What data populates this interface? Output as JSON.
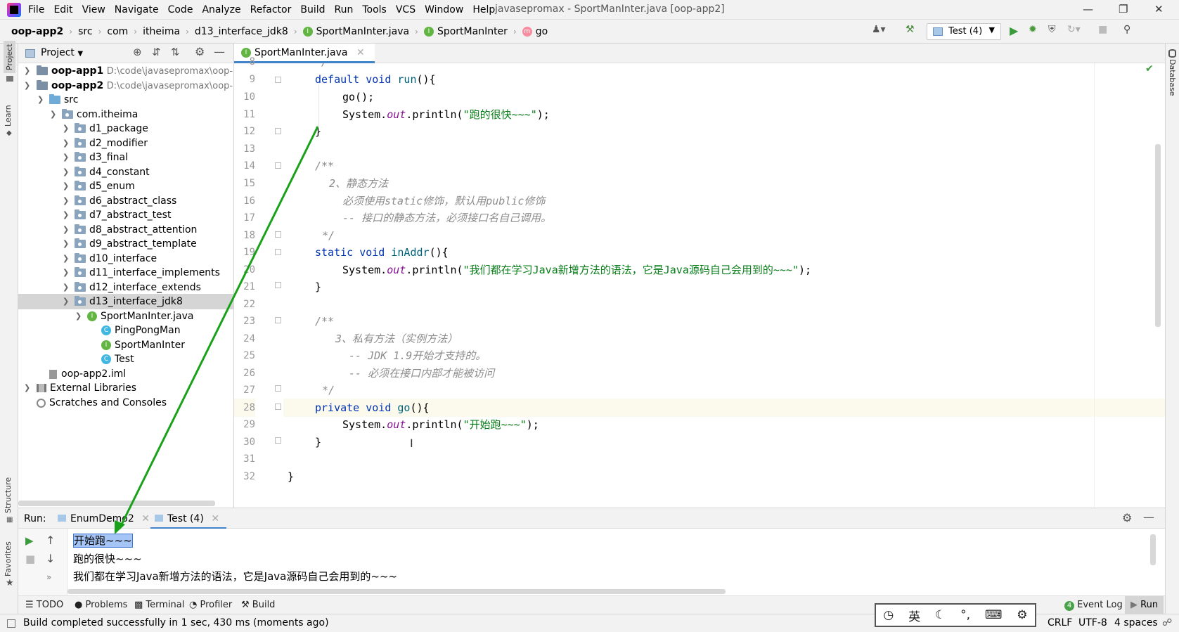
{
  "menu": {
    "items": [
      "File",
      "Edit",
      "View",
      "Navigate",
      "Code",
      "Analyze",
      "Refactor",
      "Build",
      "Run",
      "Tools",
      "VCS",
      "Window",
      "Help"
    ],
    "window_title": "javasepromax - SportManInter.java [oop-app2]"
  },
  "breadcrumbs": [
    "oop-app2",
    "src",
    "com",
    "itheima",
    "d13_interface_jdk8",
    "SportManInter.java",
    "SportManInter",
    "go"
  ],
  "run_config": "Test (4)",
  "project_panel": {
    "title": "Project",
    "rows": [
      {
        "label": "oop-app1",
        "path": "D:\\code\\javasepromax\\oop-a"
      },
      {
        "label": "oop-app2",
        "path": "D:\\code\\javasepromax\\oop-a"
      },
      {
        "label": "src"
      },
      {
        "label": "com.itheima"
      },
      {
        "label": "d1_package"
      },
      {
        "label": "d2_modifier"
      },
      {
        "label": "d3_final"
      },
      {
        "label": "d4_constant"
      },
      {
        "label": "d5_enum"
      },
      {
        "label": "d6_abstract_class"
      },
      {
        "label": "d7_abstract_test"
      },
      {
        "label": "d8_abstract_attention"
      },
      {
        "label": "d9_abstract_template"
      },
      {
        "label": "d10_interface"
      },
      {
        "label": "d11_interface_implements"
      },
      {
        "label": "d12_interface_extends"
      },
      {
        "label": "d13_interface_jdk8"
      },
      {
        "label": "SportManInter.java"
      },
      {
        "label": "PingPongMan"
      },
      {
        "label": "SportManInter"
      },
      {
        "label": "Test"
      },
      {
        "label": "oop-app2.iml"
      },
      {
        "label": "External Libraries"
      },
      {
        "label": "Scratches and Consoles"
      }
    ]
  },
  "editor": {
    "tab": "SportManInter.java",
    "line_numbers": [
      "8",
      "9",
      "10",
      "11",
      "12",
      "13",
      "14",
      "15",
      "16",
      "17",
      "18",
      "19",
      "20",
      "21",
      "22",
      "23",
      "24",
      "25",
      "26",
      "27",
      "28",
      "29",
      "30",
      "31",
      "32"
    ],
    "code": {
      "l8": "*/",
      "l9a": "default",
      "l9b": "void",
      "l9c": "run",
      "l9d": "(){",
      "l10": "go();",
      "l11a": "System.",
      "l11b": "out",
      "l11c": ".println(",
      "l11d": "\"跑的很快~~~\"",
      "l11e": ");",
      "l12": "}",
      "l14": "/**",
      "l15": "2、静态方法",
      "l16": "必须使用static修饰，默认用public修饰",
      "l17": "-- 接口的静态方法，必须接口名自己调用。",
      "l18": "*/",
      "l19a": "static",
      "l19b": "void",
      "l19c": "inAddr",
      "l19d": "(){",
      "l20a": "System.",
      "l20b": "out",
      "l20c": ".println(",
      "l20d": "\"我们都在学习Java新增方法的语法，它是Java源码自己会用到的~~~\"",
      "l20e": ");",
      "l21": "}",
      "l23": "/**",
      "l24": "3、私有方法（实例方法）",
      "l25": "-- JDK 1.9开始才支持的。",
      "l26": "-- 必须在接口内部才能被访问",
      "l27": "*/",
      "l28a": "private",
      "l28b": "void",
      "l28c": "go",
      "l28d": "(){",
      "l29a": "System.",
      "l29b": "out",
      "l29c": ".println(",
      "l29d": "\"开始跑~~~\"",
      "l29e": ");",
      "l30": "}",
      "l32": "}"
    }
  },
  "run_panel": {
    "label": "Run:",
    "tabs": [
      "EnumDemo2",
      "Test (4)"
    ],
    "output": [
      "开始跑~~~",
      "跑的很快~~~",
      "我们都在学习Java新增方法的语法，它是Java源码自己会用到的~~~"
    ]
  },
  "bottom_tools": [
    "TODO",
    "Problems",
    "Terminal",
    "Profiler",
    "Build",
    "Event Log",
    "Run"
  ],
  "event_log_count": "4",
  "status": {
    "message": "Build completed successfully in 1 sec, 430 ms (moments ago)",
    "line_sep": "CRLF",
    "encoding": "UTF-8",
    "indent": "4 spaces"
  },
  "ime": {
    "lang": "英"
  },
  "side_tabs": {
    "project": "Project",
    "learn": "Learn",
    "structure": "Structure",
    "favorites": "Favorites",
    "database": "Database"
  },
  "colors": {
    "accent": "#4083c9",
    "selection": "#d5d5d5",
    "arrow": "#1aa11a"
  }
}
